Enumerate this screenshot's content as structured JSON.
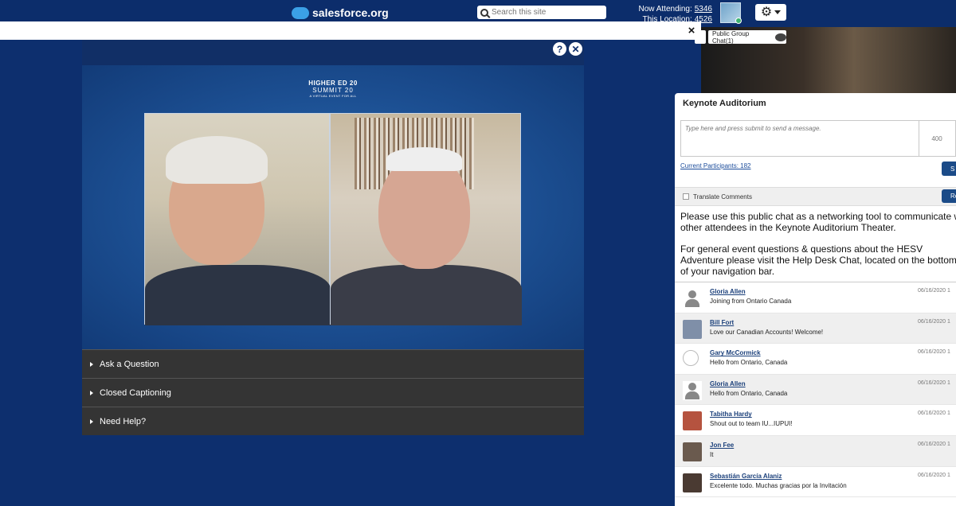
{
  "topbar": {
    "logo_text": "salesforce.org",
    "search_placeholder": "Search this site",
    "now_attending_label": "Now Attending:",
    "now_attending_value": "5346",
    "this_location_label": "This Location:",
    "this_location_value": "4526"
  },
  "strip": {
    "close_glyph": "×"
  },
  "chat_tab": {
    "label": "Public Group Chat(1)"
  },
  "video": {
    "help_glyph": "?",
    "close_glyph": "✕",
    "brand_line1": "HIGHER ED 20",
    "brand_line2": "SUMMIT 20",
    "brand_line3": "A VIRTUAL EVENT FOR ALL"
  },
  "accordion": [
    {
      "label": "Ask a Question"
    },
    {
      "label": "Closed Captioning"
    },
    {
      "label": "Need Help?"
    }
  ],
  "chat_panel": {
    "title": "Keynote Auditorium",
    "message_placeholder": "Type here and press submit to send a message.",
    "char_counter": "400",
    "participants_link": "Current Participants: 182",
    "submit_label": "S",
    "refresh_label": "Re",
    "translate_label": "Translate Comments",
    "notice_p1_line1": "Please use this public chat as a networking tool to communicate w",
    "notice_p1_line2": "other attendees in the Keynote Auditorium Theater.",
    "notice_p2_line1": "For general event questions & questions about the HESV",
    "notice_p2_line2": "Adventure please visit the Help Desk Chat, located on the bottom r",
    "notice_p2_line3": "of your navigation bar.",
    "messages": [
      {
        "name": "Gloria Allen",
        "text": "Joining from Ontario Canada",
        "time": "06/16/2020 1",
        "avatar": "generic",
        "color": "#888888"
      },
      {
        "name": "Bill Fort",
        "text": "Love our Canadian Accounts! Welcome!",
        "time": "06/16/2020 1",
        "avatar": "photo",
        "color": "#7f8fa8"
      },
      {
        "name": "Gary McCormick",
        "text": "Hello from Ontario, Canada",
        "time": "06/16/2020 1",
        "avatar": "smiley",
        "color": "#bbbbbb"
      },
      {
        "name": "Gloria Allen",
        "text": "Hello from Ontario, Canada",
        "time": "06/16/2020 1",
        "avatar": "generic",
        "color": "#888888"
      },
      {
        "name": "Tabitha Hardy",
        "text": "Shout out to team IU...IUPUI!",
        "time": "06/16/2020 1",
        "avatar": "photo",
        "color": "#b5533f"
      },
      {
        "name": "Jon Fee",
        "text": "It",
        "time": "06/16/2020 1",
        "avatar": "photo",
        "color": "#6a5a4e"
      },
      {
        "name": "Sebastián García Alaniz",
        "text": "Excelente todo. Muchas gracias por la Invitación",
        "time": "06/16/2020 1",
        "avatar": "photo",
        "color": "#4a3a32"
      }
    ]
  }
}
